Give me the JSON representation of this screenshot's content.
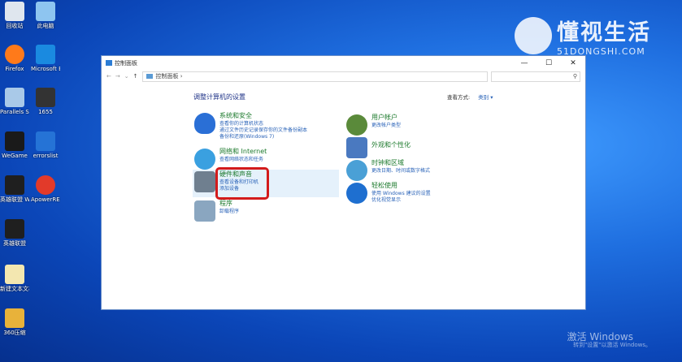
{
  "desktop": {
    "icons": [
      {
        "label": "回收站",
        "color": "#dfe6ee"
      },
      {
        "label": "此电脑",
        "color": "#8ec5f0"
      },
      {
        "label": "Firefox",
        "color": "#ff7a1a"
      },
      {
        "label": "Microsoft Edge",
        "color": "#1a8ae0"
      },
      {
        "label": "Parallels Share",
        "color": "#a9c9e8"
      },
      {
        "label": "1655",
        "color": "#333333"
      },
      {
        "label": "WeGame",
        "color": "#1a1a1a"
      },
      {
        "label": "errorslist",
        "color": "#2573d6"
      },
      {
        "label": "英雄联盟 WeGame版",
        "color": "#1f1f1f"
      },
      {
        "label": "ApowerREC",
        "color": "#e23a2a"
      },
      {
        "label": "英雄联盟",
        "color": "#1f1f1f"
      },
      {
        "label": "新建文本文档",
        "color": "#f3e7b0"
      },
      {
        "label": "360压缩",
        "color": "#e8b23a"
      }
    ]
  },
  "watermark": {
    "brand": "懂视生活",
    "domain": "51DONGSHI.COM"
  },
  "activation": {
    "line1": "激活 Windows",
    "line2": "转到\"设置\"以激活 Windows。"
  },
  "window": {
    "title": "控制面板",
    "buttons": {
      "minimize": "—",
      "maximize": "☐",
      "close": "✕"
    },
    "nav": {
      "back": "←",
      "forward": "→",
      "recent": "⌄",
      "up": "↑"
    },
    "breadcrumb": "控制面板  ›",
    "search_icon": "⚲",
    "heading": "调整计算机的设置",
    "view_by_label": "查看方式:",
    "view_by_value": "类别 ▾"
  },
  "categories_left": [
    {
      "title": "系统和安全",
      "links": [
        "查看你的计算机状态",
        "通过文件历史记录保存你的文件备份副本",
        "备份和还原(Windows 7)"
      ],
      "icon_color": "#2a6fd6"
    },
    {
      "title": "网络和 Internet",
      "links": [
        "查看网络状态和任务"
      ],
      "icon_color": "#3aa0e0"
    },
    {
      "title": "硬件和声音",
      "links": [
        "查看设备和打印机",
        "添加设备"
      ],
      "icon_color": "#6f7f8f"
    },
    {
      "title": "程序",
      "links": [
        "卸载程序"
      ],
      "icon_color": "#8aa6c0"
    }
  ],
  "categories_right": [
    {
      "title": "用户帐户",
      "links": [
        "更改帐户类型"
      ],
      "icon_color": "#5a8a3a"
    },
    {
      "title": "外观和个性化",
      "links": [],
      "icon_color": "#4a79c0"
    },
    {
      "title": "时钟和区域",
      "links": [
        "更改日期、时间或数字格式"
      ],
      "icon_color": "#4aa0d6"
    },
    {
      "title": "轻松使用",
      "links": [
        "使用 Windows 建议的设置",
        "优化视觉显示"
      ],
      "icon_color": "#1e6fd0"
    }
  ]
}
